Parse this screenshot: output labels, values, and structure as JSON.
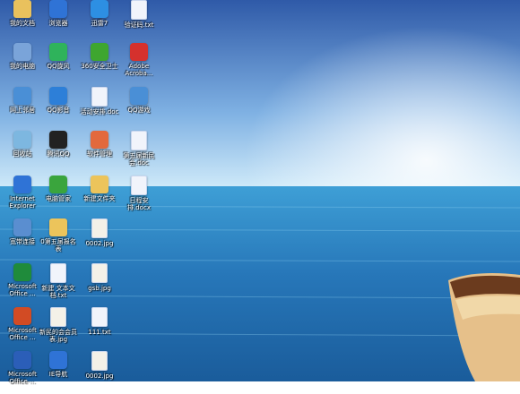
{
  "desktop": {
    "icons": [
      {
        "label": "我的文档",
        "icon": "documents-folder-icon",
        "color": "#e9c15d"
      },
      {
        "label": "浏览器",
        "icon": "browser-e-icon",
        "color": "#2f73d6"
      },
      {
        "label": "迅雷7",
        "icon": "thunder-bird-icon",
        "color": "#2d8fe3"
      },
      {
        "label": "验证码.txt",
        "icon": "text-file-icon",
        "color": "#f1f4fb"
      },
      {
        "label": "我的电脑",
        "icon": "computer-icon",
        "color": "#7aa4d9"
      },
      {
        "label": "QQ旋风",
        "icon": "qq-whirlwind-icon",
        "color": "#2fb35b"
      },
      {
        "label": "360安全卫士",
        "icon": "360-security-icon",
        "color": "#3ea62f"
      },
      {
        "label": "Adobe Acroba...",
        "icon": "adobe-acrobat-icon",
        "color": "#d5312d"
      },
      {
        "label": "网上邻居",
        "icon": "network-places-icon",
        "color": "#4a8fd6"
      },
      {
        "label": "QQ影音",
        "icon": "qq-player-icon",
        "color": "#2d7fd8"
      },
      {
        "label": "活动安排.doc",
        "icon": "word-document-icon",
        "color": "#f1f4fb"
      },
      {
        "label": "QQ游戏",
        "icon": "qq-game-icon",
        "color": "#4a8fd6"
      },
      {
        "label": "回收站",
        "icon": "recycle-bin-icon",
        "color": "#7db7e0"
      },
      {
        "label": "腾讯QQ",
        "icon": "qq-penguin-icon",
        "color": "#222222"
      },
      {
        "label": "软件管理",
        "icon": "software-manager-icon",
        "color": "#e2693d"
      },
      {
        "label": "第五届新民会.doc",
        "icon": "word-document-icon",
        "color": "#f1f4fb"
      },
      {
        "label": "Internet Explorer",
        "icon": "internet-explorer-icon",
        "color": "#2f73d6"
      },
      {
        "label": "电脑管家",
        "icon": "pc-manager-shield-icon",
        "color": "#3aa53d"
      },
      {
        "label": "新建文件夹",
        "icon": "folder-icon",
        "color": "#ecc45b"
      },
      {
        "label": "日程安排.docx",
        "icon": "word-document-icon",
        "color": "#f1f4fb"
      },
      {
        "label": "宽带连接",
        "icon": "broadband-connection-icon",
        "color": "#5a8ed0"
      },
      {
        "label": "0第五届报名表",
        "icon": "folder-icon",
        "color": "#ecc45b"
      },
      {
        "label": "0002.jpg",
        "icon": "image-file-icon",
        "color": "#f4f1e8"
      },
      {
        "label": "Microsoft Office ...",
        "icon": "excel-icon",
        "color": "#1f8b3b"
      },
      {
        "label": "新建 文本文档.txt",
        "icon": "text-file-icon",
        "color": "#f1f4fb"
      },
      {
        "label": "gsb.jpg",
        "icon": "image-file-icon",
        "color": "#f4f1e8"
      },
      {
        "label": "Microsoft Office ...",
        "icon": "powerpoint-icon",
        "color": "#d24b24"
      },
      {
        "label": "新民的会会员表.jpg",
        "icon": "image-file-icon",
        "color": "#f4f1e8"
      },
      {
        "label": "111.txt",
        "icon": "text-file-icon",
        "color": "#f1f4fb"
      },
      {
        "label": "Microsoft Office ...",
        "icon": "word-icon",
        "color": "#2b5eb8"
      },
      {
        "label": "IE导航",
        "icon": "ie-navigation-icon",
        "color": "#2f73d6"
      },
      {
        "label": "0002.jpg",
        "icon": "image-file-icon",
        "color": "#f4f1e8"
      }
    ]
  },
  "colors": {
    "sky_top": "#2f5aa8",
    "sky_horizon": "#b9dff6",
    "sea": "#2a7fc1",
    "sea_deep": "#1b5a98"
  }
}
